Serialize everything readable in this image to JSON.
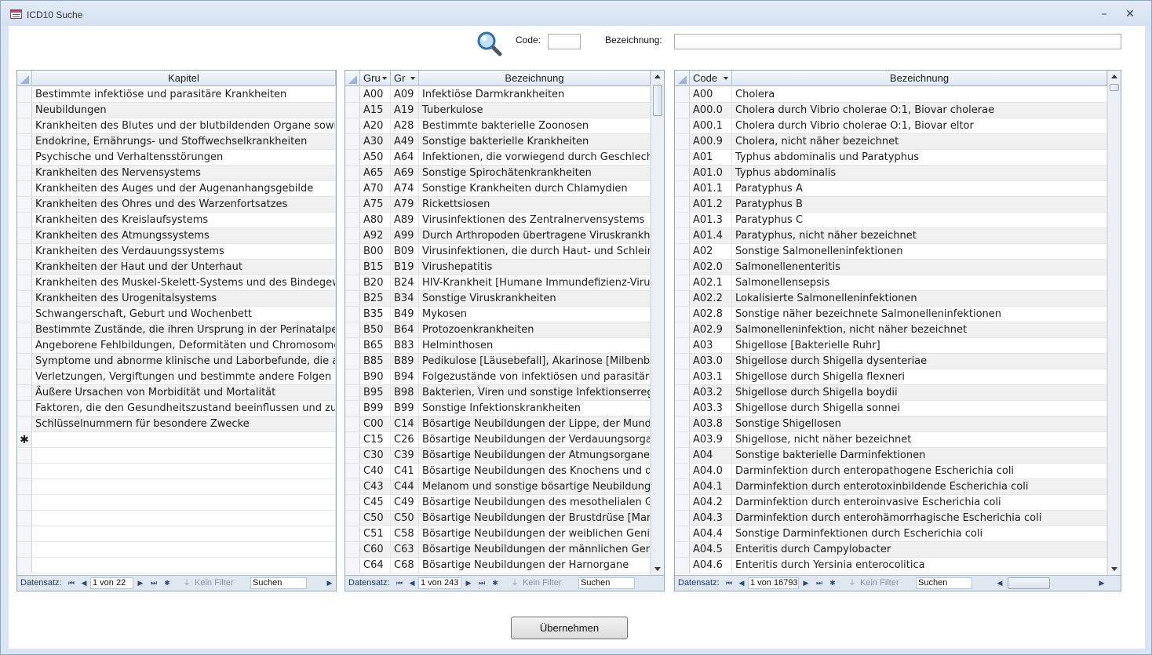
{
  "window": {
    "title": "ICD10 Suche",
    "minimize": "–",
    "close": "✕"
  },
  "search": {
    "code_label": "Code:",
    "code_value": "",
    "bez_label": "Bezeichnung:",
    "bez_value": ""
  },
  "kapitel": {
    "header": "Kapitel",
    "rows": [
      "Bestimmte infektiöse und parasitäre Krankheiten",
      "Neubildungen",
      "Krankheiten des Blutes und der blutbildenden Organe sowie b",
      "Endokrine, Ernährungs- und Stoffwechselkrankheiten",
      "Psychische und Verhaltensstörungen",
      "Krankheiten des Nervensystems",
      "Krankheiten des Auges und der Augenanhangsgebilde",
      "Krankheiten des Ohres und des Warzenfortsatzes",
      "Krankheiten des Kreislaufsystems",
      "Krankheiten des Atmungssystems",
      "Krankheiten des Verdauungssystems",
      "Krankheiten der Haut und der Unterhaut",
      "Krankheiten des Muskel-Skelett-Systems und des Bindegeweb",
      "Krankheiten des Urogenitalsystems",
      "Schwangerschaft, Geburt und Wochenbett",
      "Bestimmte Zustände, die ihren Ursprung in der Perinatalperioc",
      "Angeborene Fehlbildungen, Deformitäten und Chromosomena",
      "Symptome und abnorme klinische und Laborbefunde, die ande",
      "Verletzungen, Vergiftungen und bestimmte andere Folgen äuß",
      "Äußere Ursachen von Morbidität und Mortalität",
      "Faktoren, die den Gesundheitszustand beeinflussen und zur In",
      "Schlüsselnummern für besondere Zwecke"
    ],
    "new_row_marker": "✱",
    "nav": {
      "label": "Datensatz:",
      "record": "1 von 22",
      "filter": "Kein Filter",
      "search": "Suchen"
    }
  },
  "gruppen": {
    "headers": [
      "Gru",
      "Gr",
      "Bezeichnung"
    ],
    "rows": [
      [
        "A00",
        "A09",
        "Infektiöse Darmkrankheiten"
      ],
      [
        "A15",
        "A19",
        "Tuberkulose"
      ],
      [
        "A20",
        "A28",
        "Bestimmte bakterielle Zoonosen"
      ],
      [
        "A30",
        "A49",
        "Sonstige bakterielle Krankheiten"
      ],
      [
        "A50",
        "A64",
        "Infektionen, die vorwiegend durch Geschlechts"
      ],
      [
        "A65",
        "A69",
        "Sonstige Spirochätenkrankheiten"
      ],
      [
        "A70",
        "A74",
        "Sonstige Krankheiten durch Chlamydien"
      ],
      [
        "A75",
        "A79",
        "Rickettsiosen"
      ],
      [
        "A80",
        "A89",
        "Virusinfektionen des Zentralnervensystems"
      ],
      [
        "A92",
        "A99",
        "Durch Arthropoden übertragene Viruskrankheit"
      ],
      [
        "B00",
        "B09",
        "Virusinfektionen, die durch Haut- und Schleimh"
      ],
      [
        "B15",
        "B19",
        "Virushepatitis"
      ],
      [
        "B20",
        "B24",
        "HIV-Krankheit [Humane Immundefizienz-Virusk"
      ],
      [
        "B25",
        "B34",
        "Sonstige Viruskrankheiten"
      ],
      [
        "B35",
        "B49",
        "Mykosen"
      ],
      [
        "B50",
        "B64",
        "Protozoenkrankheiten"
      ],
      [
        "B65",
        "B83",
        "Helminthosen"
      ],
      [
        "B85",
        "B89",
        "Pedikulose [Läusebefall], Akarinose [Milbenbef"
      ],
      [
        "B90",
        "B94",
        "Folgezustände von infektiösen und parasitären"
      ],
      [
        "B95",
        "B98",
        "Bakterien, Viren und sonstige Infektionserreger"
      ],
      [
        "B99",
        "B99",
        "Sonstige Infektionskrankheiten"
      ],
      [
        "C00",
        "C14",
        "Bösartige Neubildungen der Lippe, der Mundhö"
      ],
      [
        "C15",
        "C26",
        "Bösartige Neubildungen der Verdauungsorgane"
      ],
      [
        "C30",
        "C39",
        "Bösartige Neubildungen der Atmungsorgane un"
      ],
      [
        "C40",
        "C41",
        "Bösartige Neubildungen des Knochens und des"
      ],
      [
        "C43",
        "C44",
        "Melanom und sonstige bösartige Neubildungen"
      ],
      [
        "C45",
        "C49",
        "Bösartige Neubildungen des mesothelialen Gev"
      ],
      [
        "C50",
        "C50",
        "Bösartige Neubildungen der Brustdrüse [Mamm"
      ],
      [
        "C51",
        "C58",
        "Bösartige Neubildungen der weiblichen Genital"
      ],
      [
        "C60",
        "C63",
        "Bösartige Neubildungen der männlichen Genita"
      ],
      [
        "C64",
        "C68",
        "Bösartige Neubildungen der Harnorgane"
      ]
    ],
    "nav": {
      "label": "Datensatz:",
      "record": "1 von 243",
      "filter": "Kein Filter",
      "search": "Suchen"
    }
  },
  "codes": {
    "headers": [
      "Code",
      "Bezeichnung"
    ],
    "rows": [
      [
        "A00",
        "Cholera"
      ],
      [
        "A00.0",
        "Cholera durch Vibrio cholerae O:1, Biovar cholerae"
      ],
      [
        "A00.1",
        "Cholera durch Vibrio cholerae O:1, Biovar eltor"
      ],
      [
        "A00.9",
        "Cholera, nicht näher bezeichnet"
      ],
      [
        "A01",
        "Typhus abdominalis und Paratyphus"
      ],
      [
        "A01.0",
        "Typhus abdominalis"
      ],
      [
        "A01.1",
        "Paratyphus A"
      ],
      [
        "A01.2",
        "Paratyphus B"
      ],
      [
        "A01.3",
        "Paratyphus C"
      ],
      [
        "A01.4",
        "Paratyphus, nicht näher bezeichnet"
      ],
      [
        "A02",
        "Sonstige Salmonelleninfektionen"
      ],
      [
        "A02.0",
        "Salmonellenenteritis"
      ],
      [
        "A02.1",
        "Salmonellensepsis"
      ],
      [
        "A02.2",
        "Lokalisierte Salmonelleninfektionen"
      ],
      [
        "A02.8",
        "Sonstige näher bezeichnete Salmonelleninfektionen"
      ],
      [
        "A02.9",
        "Salmonelleninfektion, nicht näher bezeichnet"
      ],
      [
        "A03",
        "Shigellose [Bakterielle Ruhr]"
      ],
      [
        "A03.0",
        "Shigellose durch Shigella dysenteriae"
      ],
      [
        "A03.1",
        "Shigellose durch Shigella flexneri"
      ],
      [
        "A03.2",
        "Shigellose durch Shigella boydii"
      ],
      [
        "A03.3",
        "Shigellose durch Shigella sonnei"
      ],
      [
        "A03.8",
        "Sonstige Shigellosen"
      ],
      [
        "A03.9",
        "Shigellose, nicht näher bezeichnet"
      ],
      [
        "A04",
        "Sonstige bakterielle Darminfektionen"
      ],
      [
        "A04.0",
        "Darminfektion durch enteropathogene Escherichia coli"
      ],
      [
        "A04.1",
        "Darminfektion durch enterotoxinbildende Escherichia coli"
      ],
      [
        "A04.2",
        "Darminfektion durch enteroinvasive Escherichia coli"
      ],
      [
        "A04.3",
        "Darminfektion durch enterohämorrhagische Escherichia coli"
      ],
      [
        "A04.4",
        "Sonstige Darminfektionen durch Escherichia coli"
      ],
      [
        "A04.5",
        "Enteritis durch Campylobacter"
      ],
      [
        "A04.6",
        "Enteritis durch Yersinia enterocolitica"
      ]
    ],
    "nav": {
      "label": "Datensatz:",
      "record": "1 von 16793",
      "filter": "Kein Filter",
      "search": "Suchen"
    }
  },
  "buttons": {
    "submit": "Übernehmen"
  },
  "colors": {
    "accent": "#c4d5ec",
    "header_bg": "#e0e7f1",
    "alt_row": "#f0f0f0"
  }
}
